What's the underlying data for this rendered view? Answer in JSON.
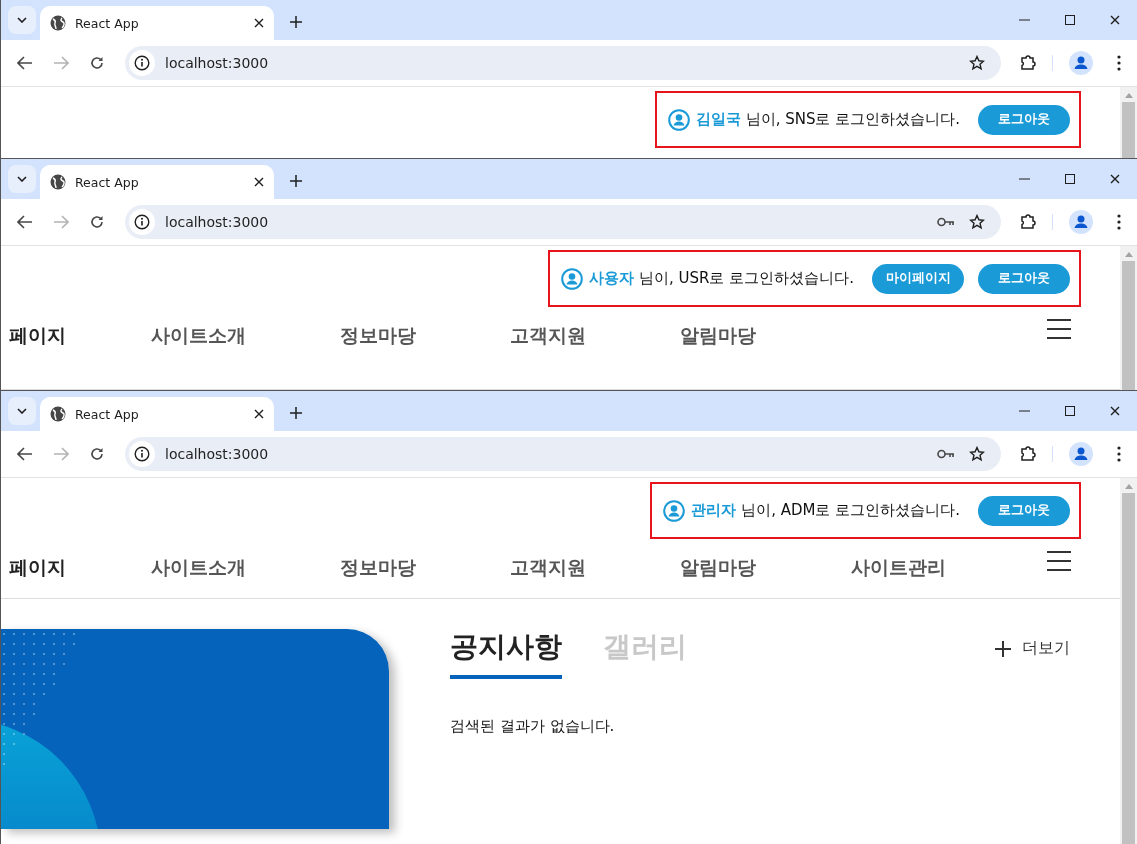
{
  "windows": [
    {
      "tab": {
        "title": "React App"
      },
      "forward_disabled": true,
      "url": "localhost:3000",
      "login": {
        "user": "김일국",
        "message": "님이, SNS로 로그인하셨습니다.",
        "buttons": [
          "로그아웃"
        ]
      }
    },
    {
      "tab": {
        "title": "React App"
      },
      "forward_disabled": true,
      "url": "localhost:3000",
      "password_key": true,
      "login": {
        "user": "사용자",
        "message": "님이, USR로 로그인하셨습니다.",
        "buttons": [
          "마이페이지",
          "로그아웃"
        ]
      },
      "nav": {
        "logo": "페이지",
        "items": [
          "사이트소개",
          "정보마당",
          "고객지원",
          "알림마당"
        ]
      }
    },
    {
      "tab": {
        "title": "React App"
      },
      "forward_disabled": true,
      "url": "localhost:3000",
      "password_key": true,
      "login": {
        "user": "관리자",
        "message": "님이, ADM로 로그인하셨습니다.",
        "buttons": [
          "로그아웃"
        ]
      },
      "nav": {
        "logo": "페이지",
        "items": [
          "사이트소개",
          "정보마당",
          "고객지원",
          "알림마당",
          "사이트관리"
        ]
      },
      "board": {
        "tabs": [
          {
            "label": "공지사항",
            "selected": true
          },
          {
            "label": "갤러리",
            "selected": false
          }
        ],
        "more": "더보기",
        "empty_message": "검색된 결과가 없습니다."
      }
    }
  ]
}
